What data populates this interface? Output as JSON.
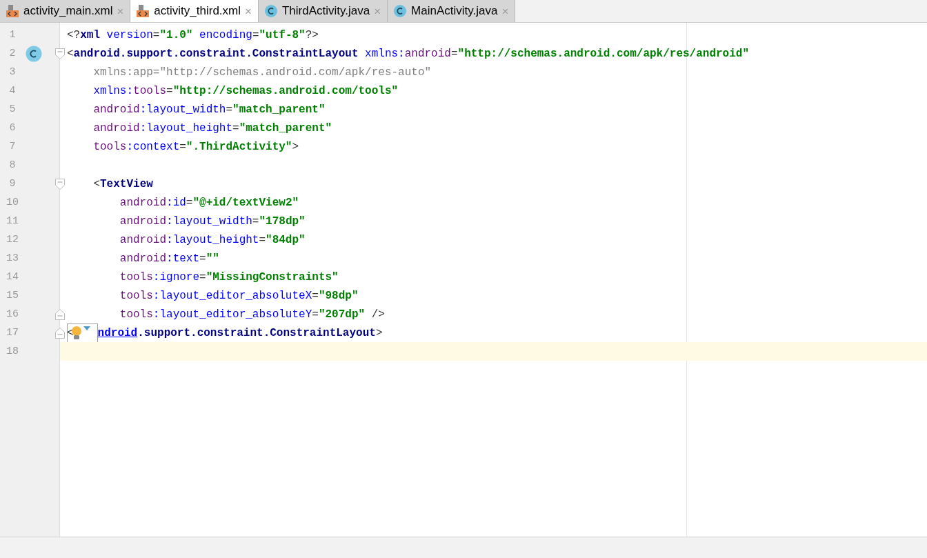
{
  "tabs": [
    {
      "label": "activity_main.xml",
      "kind": "xml",
      "close": "×",
      "selected": false
    },
    {
      "label": "activity_third.xml",
      "kind": "xml",
      "close": "×",
      "selected": true
    },
    {
      "label": "ThirdActivity.java",
      "kind": "class",
      "close": "×",
      "selected": false
    },
    {
      "label": "MainActivity.java",
      "kind": "class",
      "close": "×",
      "selected": false
    }
  ],
  "editor": {
    "lines": [
      {
        "number": "1",
        "tokens": [
          {
            "text": "<?",
            "kind": "punct"
          },
          {
            "text": "xml ",
            "kind": "tag"
          },
          {
            "text": "version",
            "kind": "attr"
          },
          {
            "text": "=",
            "kind": "punct"
          },
          {
            "text": "\"1.0\"",
            "kind": "value"
          },
          {
            "text": " encoding",
            "kind": "attr"
          },
          {
            "text": "=",
            "kind": "punct"
          },
          {
            "text": "\"utf-8\"",
            "kind": "value"
          },
          {
            "text": "?>",
            "kind": "punct"
          }
        ]
      },
      {
        "number": "2",
        "class_marker": true,
        "fold_start": true,
        "tokens": [
          {
            "text": "<",
            "kind": "punct"
          },
          {
            "text": "android.support.constraint.ConstraintLayout",
            "kind": "tag"
          },
          {
            "text": " xmlns",
            "kind": "attr"
          },
          {
            "text": ":",
            "kind": "attr"
          },
          {
            "text": "android",
            "kind": "ns"
          },
          {
            "text": "=",
            "kind": "punct"
          },
          {
            "text": "\"http://schemas.android.com/apk/res/android\"",
            "kind": "value"
          }
        ]
      },
      {
        "number": "3",
        "tokens": [
          {
            "text": "    xmlns:app=\"http://schemas.android.com/apk/res-auto\"",
            "kind": "muted"
          }
        ]
      },
      {
        "number": "4",
        "tokens": [
          {
            "text": "    xmlns",
            "kind": "attr"
          },
          {
            "text": ":",
            "kind": "attr"
          },
          {
            "text": "tools",
            "kind": "ns"
          },
          {
            "text": "=",
            "kind": "punct"
          },
          {
            "text": "\"http://schemas.android.com/tools\"",
            "kind": "value"
          }
        ]
      },
      {
        "number": "5",
        "tokens": [
          {
            "text": "    android",
            "kind": "ns"
          },
          {
            "text": ":layout_width",
            "kind": "attr"
          },
          {
            "text": "=",
            "kind": "punct"
          },
          {
            "text": "\"match_parent\"",
            "kind": "value"
          }
        ]
      },
      {
        "number": "6",
        "tokens": [
          {
            "text": "    android",
            "kind": "ns"
          },
          {
            "text": ":layout_height",
            "kind": "attr"
          },
          {
            "text": "=",
            "kind": "punct"
          },
          {
            "text": "\"match_parent\"",
            "kind": "value"
          }
        ]
      },
      {
        "number": "7",
        "tokens": [
          {
            "text": "    tools",
            "kind": "ns"
          },
          {
            "text": ":context",
            "kind": "attr"
          },
          {
            "text": "=",
            "kind": "punct"
          },
          {
            "text": "\".ThirdActivity\"",
            "kind": "value"
          },
          {
            "text": ">",
            "kind": "punct"
          }
        ]
      },
      {
        "number": "8"
      },
      {
        "number": "9",
        "fold_start": true,
        "tokens": [
          {
            "text": "    <",
            "kind": "punct"
          },
          {
            "text": "TextView",
            "kind": "tag"
          }
        ]
      },
      {
        "number": "10",
        "tokens": [
          {
            "text": "        android",
            "kind": "ns"
          },
          {
            "text": ":id",
            "kind": "attr"
          },
          {
            "text": "=",
            "kind": "punct"
          },
          {
            "text": "\"@+id/textView2\"",
            "kind": "value"
          }
        ]
      },
      {
        "number": "11",
        "tokens": [
          {
            "text": "        android",
            "kind": "ns"
          },
          {
            "text": ":layout_width",
            "kind": "attr"
          },
          {
            "text": "=",
            "kind": "punct"
          },
          {
            "text": "\"178dp\"",
            "kind": "value"
          }
        ]
      },
      {
        "number": "12",
        "tokens": [
          {
            "text": "        android",
            "kind": "ns"
          },
          {
            "text": ":layout_height",
            "kind": "attr"
          },
          {
            "text": "=",
            "kind": "punct"
          },
          {
            "text": "\"84dp\"",
            "kind": "value"
          }
        ]
      },
      {
        "number": "13",
        "tokens": [
          {
            "text": "        android",
            "kind": "ns"
          },
          {
            "text": ":text",
            "kind": "attr"
          },
          {
            "text": "=",
            "kind": "punct"
          },
          {
            "text": "\"\"",
            "kind": "value"
          }
        ]
      },
      {
        "number": "14",
        "tokens": [
          {
            "text": "        tools",
            "kind": "ns"
          },
          {
            "text": ":ignore",
            "kind": "attr"
          },
          {
            "text": "=",
            "kind": "punct"
          },
          {
            "text": "\"MissingConstraints\"",
            "kind": "value"
          }
        ]
      },
      {
        "number": "15",
        "tokens": [
          {
            "text": "        tools",
            "kind": "ns"
          },
          {
            "text": ":layout_editor_absoluteX",
            "kind": "attr"
          },
          {
            "text": "=",
            "kind": "punct"
          },
          {
            "text": "\"98dp\"",
            "kind": "value"
          }
        ]
      },
      {
        "number": "16",
        "fold_end": true,
        "tokens": [
          {
            "text": "        tools",
            "kind": "ns"
          },
          {
            "text": ":layout_editor_absoluteY",
            "kind": "attr"
          },
          {
            "text": "=",
            "kind": "punct"
          },
          {
            "text": "\"207dp\"",
            "kind": "value"
          },
          {
            "text": " />",
            "kind": "punct"
          }
        ]
      },
      {
        "number": "17",
        "fold_end": true,
        "prefix": "<",
        "intention": true,
        "tokens": [
          {
            "text": "ndroid",
            "kind": "link"
          },
          {
            "text": ".support.constraint.ConstraintLayout",
            "kind": "tag"
          },
          {
            "text": ">",
            "kind": "punct"
          }
        ]
      },
      {
        "number": "18",
        "current": true
      }
    ]
  }
}
